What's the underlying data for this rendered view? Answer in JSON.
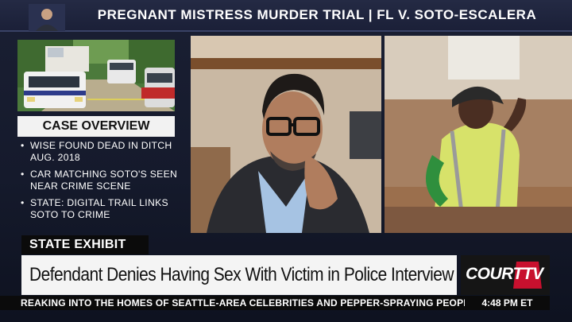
{
  "banner": {
    "title": "PREGNANT MISTRESS MURDER TRIAL | FL V. SOTO-ESCALERA"
  },
  "case_overview": {
    "heading": "CASE OVERVIEW",
    "items": [
      "WISE FOUND DEAD IN DITCH AUG. 2018",
      "CAR MATCHING SOTO'S SEEN NEAR CRIME SCENE",
      "STATE: DIGITAL TRAIL LINKS SOTO TO CRIME"
    ]
  },
  "lower_third": {
    "tag": "STATE EXHIBIT",
    "headline": "Defendant Denies Having Sex With Victim in Police Interview"
  },
  "logo": {
    "text": "COURT",
    "suffix": "TV"
  },
  "ticker": {
    "text": "REAKING INTO THE HOMES OF SEATTLE-AREA CELEBRITIES AND PEPPER-SPRAYING PEOPLE"
  },
  "clock": {
    "time": "4:48 PM ET"
  },
  "colors": {
    "banner": "#1f2540",
    "accent": "#c8102e",
    "lower_third_bg": "#f4f4f4"
  }
}
